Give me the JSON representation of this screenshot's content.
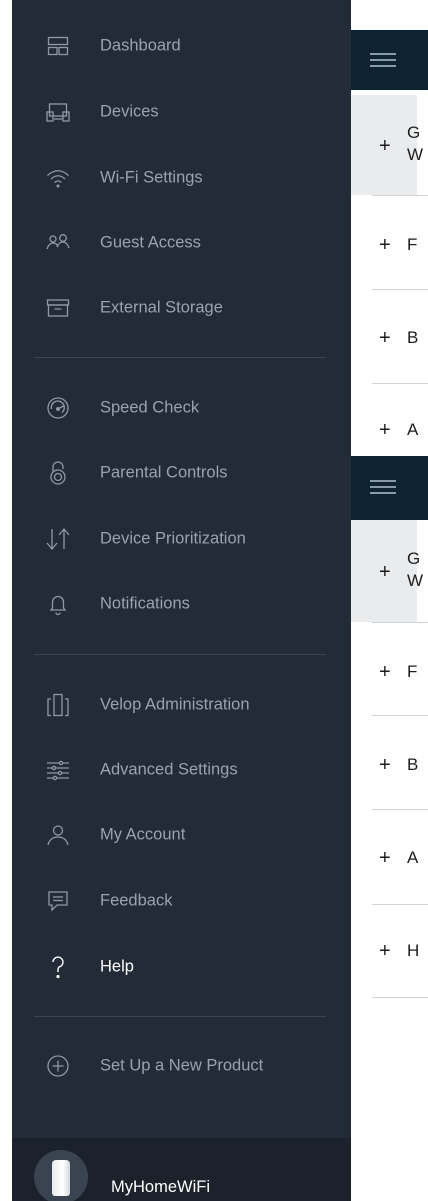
{
  "menu": {
    "items": [
      {
        "label": "Dashboard",
        "icon": "dashboard-icon"
      },
      {
        "label": "Devices",
        "icon": "devices-icon"
      },
      {
        "label": "Wi-Fi Settings",
        "icon": "wifi-icon"
      },
      {
        "label": "Guest Access",
        "icon": "guest-access-icon"
      },
      {
        "label": "External Storage",
        "icon": "external-storage-icon"
      },
      {
        "label": "Speed Check",
        "icon": "speed-check-icon"
      },
      {
        "label": "Parental Controls",
        "icon": "parental-controls-icon"
      },
      {
        "label": "Device Prioritization",
        "icon": "device-prioritization-icon"
      },
      {
        "label": "Notifications",
        "icon": "notifications-icon"
      },
      {
        "label": "Velop Administration",
        "icon": "velop-administration-icon"
      },
      {
        "label": "Advanced Settings",
        "icon": "advanced-settings-icon"
      },
      {
        "label": "My Account",
        "icon": "my-account-icon"
      },
      {
        "label": "Feedback",
        "icon": "feedback-icon"
      },
      {
        "label": "Help",
        "icon": "help-icon",
        "active": true
      },
      {
        "label": "Set Up a New Product",
        "icon": "add-product-icon"
      }
    ]
  },
  "footer": {
    "network_name": "MyHomeWiFi"
  },
  "content": {
    "rows_top": [
      {
        "plus": "+",
        "text": "G\nW"
      },
      {
        "plus": "+",
        "text": "F"
      },
      {
        "plus": "+",
        "text": "B"
      },
      {
        "plus": "+",
        "text": "A"
      }
    ],
    "rows_bottom": [
      {
        "plus": "+",
        "text": "G\nW"
      },
      {
        "plus": "+",
        "text": "F"
      },
      {
        "plus": "+",
        "text": "B"
      },
      {
        "plus": "+",
        "text": "A"
      },
      {
        "plus": "+",
        "text": "H"
      }
    ]
  },
  "colors": {
    "drawer_bg": "#232b38",
    "footer_bg": "#1b222c",
    "topbar_bg": "#0e2233",
    "label_inactive": "#9aa2ae",
    "label_active": "#ffffff"
  }
}
